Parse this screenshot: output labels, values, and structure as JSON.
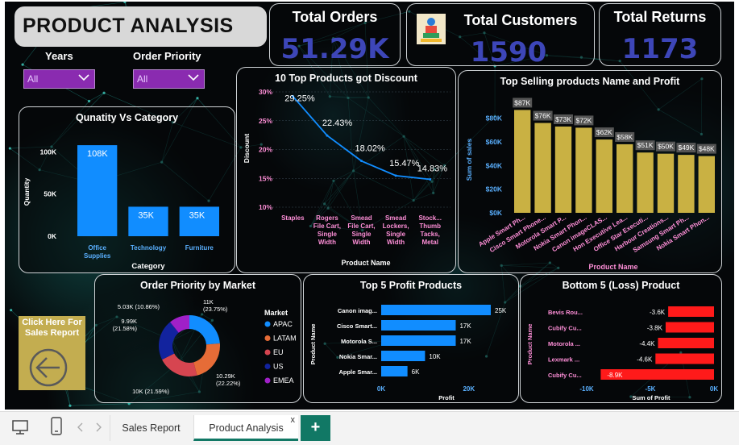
{
  "page_title": "PRODUCT ANALYSIS",
  "kpis": {
    "orders": {
      "label": "Total Orders",
      "value": "51.29K"
    },
    "customers": {
      "label": "Total Customers",
      "value": "1590"
    },
    "returns": {
      "label": "Total Returns",
      "value": "1173"
    }
  },
  "slicers": {
    "years": {
      "label": "Years",
      "value": "All"
    },
    "priority": {
      "label": "Order Priority",
      "value": "All"
    }
  },
  "report_button": {
    "label_line1": "Click Here For",
    "label_line2": "Sales Report"
  },
  "tabs": [
    {
      "label": "Sales Report"
    },
    {
      "label": "Product Analysis",
      "close": "x"
    }
  ],
  "add_tab_label": "+",
  "colors": {
    "blue": "#118dff",
    "gold": "#c9b143",
    "red": "#ff1a1a",
    "kpi": "#3d46b8"
  },
  "chart_data": [
    {
      "id": "qty",
      "type": "bar",
      "title": "Qunatity Vs Category",
      "xlabel": "Category",
      "ylabel": "Quantity",
      "categories": [
        "Office Supplies",
        "Technology",
        "Furniture"
      ],
      "values": [
        108000,
        35000,
        35000
      ],
      "data_labels": [
        "108K",
        "35K",
        "35K"
      ],
      "ylim": [
        0,
        110000
      ],
      "yticks": [
        0,
        50000,
        100000
      ],
      "ytick_labels": [
        "0K",
        "50K",
        "100K"
      ]
    },
    {
      "id": "discount",
      "type": "line",
      "title": "10 Top Products got Discount",
      "xlabel": "Product Name",
      "ylabel": "Discount",
      "categories": [
        "Staples",
        "Rogers File Cart, Single Width",
        "Smead File Cart, Single Width",
        "Smead Lockers, Single Width",
        "Stockw... Thumb Tacks, Metal"
      ],
      "values": [
        29.25,
        22.43,
        18.02,
        15.47,
        14.83
      ],
      "data_labels": [
        "29.25%",
        "22.43%",
        "18.02%",
        "15.47%",
        "14.83%"
      ],
      "ylim": [
        10,
        30
      ],
      "yticks": [
        10,
        15,
        20,
        25,
        30
      ],
      "ytick_labels": [
        "10%",
        "15%",
        "20%",
        "25%",
        "30%"
      ]
    },
    {
      "id": "topsell",
      "type": "bar",
      "title": "Top Selling products Name and Profit",
      "xlabel": "Product Name",
      "ylabel": "Sum of sales",
      "categories": [
        "Apple Smart Ph...",
        "Cisco Smart Phone...",
        "Motorola Smart P...",
        "Nokia Smart Phon...",
        "Canon imageCLAS...",
        "Hon Executive Lea...",
        "Office Star Executi...",
        "Harbour Creations...",
        "Samsung Smart Ph...",
        "Nokia Smart Phon..."
      ],
      "values": [
        87000,
        76000,
        73000,
        72000,
        62000,
        58000,
        51000,
        50000,
        49000,
        48000
      ],
      "data_labels": [
        "$87K",
        "$76K",
        "$73K",
        "$72K",
        "$62K",
        "$58K",
        "$51K",
        "$50K",
        "$49K",
        "$48K"
      ],
      "ylim": [
        0,
        90000
      ],
      "yticks": [
        0,
        20000,
        40000,
        60000,
        80000
      ],
      "ytick_labels": [
        "$0K",
        "$20K",
        "$40K",
        "$60K",
        "$80K"
      ]
    },
    {
      "id": "donut",
      "type": "pie",
      "title": "Order Priority by Market",
      "legend_title": "Market",
      "categories": [
        "APAC",
        "LATAM",
        "EU",
        "US",
        "EMEA"
      ],
      "values": [
        23.75,
        22.22,
        21.59,
        21.58,
        10.86
      ],
      "colors": [
        "#118dff",
        "#e66c37",
        "#d64550",
        "#12239e",
        "#a020c8"
      ],
      "data_labels": [
        "11K (23.75%)",
        "10.29K (22.22%)",
        "10K (21.59%)",
        "9.99K (21.58%)",
        "5.03K (10.86%)"
      ]
    },
    {
      "id": "top5",
      "type": "bar",
      "title": "Top 5 Profit Products",
      "xlabel": "Profit",
      "ylabel": "Product Name",
      "categories": [
        "Canon imag...",
        "Cisco Smart...",
        "Motorola S...",
        "Nokia Smar...",
        "Apple Smar..."
      ],
      "values": [
        25000,
        17000,
        17000,
        10000,
        6000
      ],
      "data_labels": [
        "25K",
        "17K",
        "17K",
        "10K",
        "6K"
      ],
      "xlim": [
        0,
        25000
      ],
      "xticks": [
        0,
        20000
      ],
      "xtick_labels": [
        "0K",
        "20K"
      ]
    },
    {
      "id": "bottom5",
      "type": "bar",
      "title": "Bottom 5 (Loss) Product",
      "xlabel": "Sum of Profit",
      "ylabel": "Product Name",
      "categories": [
        "Bevis Rou...",
        "Cubify Cu...",
        "Motorola ...",
        "Lexmark ...",
        "Cubify Cu..."
      ],
      "values": [
        -3600,
        -3800,
        -4400,
        -4600,
        -8900
      ],
      "data_labels": [
        "-3.6K",
        "-3.8K",
        "-4.4K",
        "-4.6K",
        "-8.9K"
      ],
      "xlim": [
        -10000,
        0
      ],
      "xticks": [
        -10000,
        -5000,
        0
      ],
      "xtick_labels": [
        "-10K",
        "-5K",
        "0K"
      ]
    }
  ]
}
